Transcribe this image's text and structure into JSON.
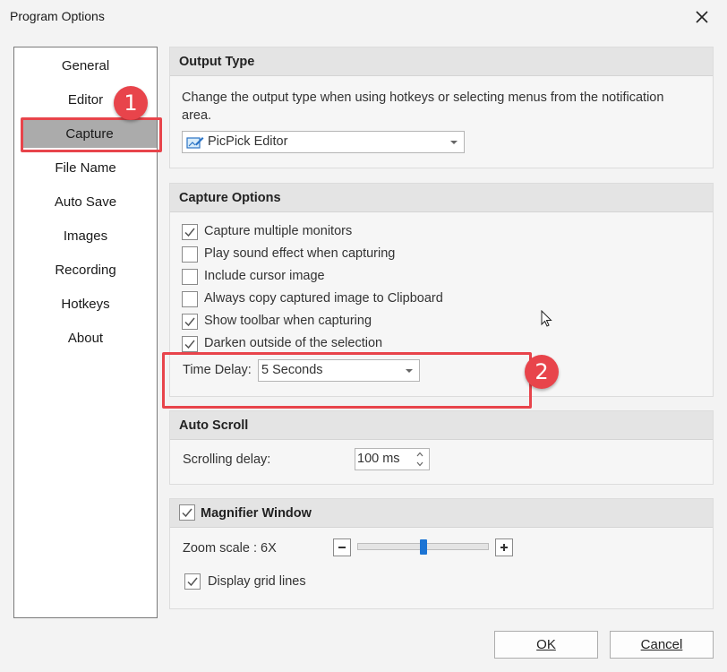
{
  "window": {
    "title": "Program Options"
  },
  "sidebar": {
    "items": [
      {
        "label": "General"
      },
      {
        "label": "Editor"
      },
      {
        "label": "Capture",
        "active": true
      },
      {
        "label": "File Name"
      },
      {
        "label": "Auto Save"
      },
      {
        "label": "Images"
      },
      {
        "label": "Recording"
      },
      {
        "label": "Hotkeys"
      },
      {
        "label": "About"
      }
    ]
  },
  "output_type": {
    "header": "Output Type",
    "description": "Change the output type when using hotkeys or selecting menus from the notification area.",
    "selected": "PicPick Editor",
    "selected_icon": "picpick-editor-icon"
  },
  "capture_options": {
    "header": "Capture Options",
    "options": [
      {
        "label": "Capture multiple monitors",
        "checked": true
      },
      {
        "label": "Play sound effect when capturing",
        "checked": false
      },
      {
        "label": "Include cursor image",
        "checked": false
      },
      {
        "label": "Always copy captured image to Clipboard",
        "checked": false
      },
      {
        "label": "Show toolbar when capturing",
        "checked": true
      },
      {
        "label": "Darken outside of the selection",
        "checked": true
      }
    ],
    "time_delay_label": "Time Delay:",
    "time_delay_value": "5 Seconds"
  },
  "auto_scroll": {
    "header": "Auto Scroll",
    "label": "Scrolling delay:",
    "value": "100 ms"
  },
  "magnifier": {
    "header": "Magnifier Window",
    "enabled": true,
    "zoom_label": "Zoom scale : 6X",
    "zoom_level_fraction": 0.5,
    "grid_label": "Display grid lines",
    "grid_checked": true
  },
  "buttons": {
    "ok": "OK",
    "cancel": "Cancel"
  },
  "annotations": {
    "badge1": "1",
    "badge2": "2",
    "color": "#e8444b"
  }
}
